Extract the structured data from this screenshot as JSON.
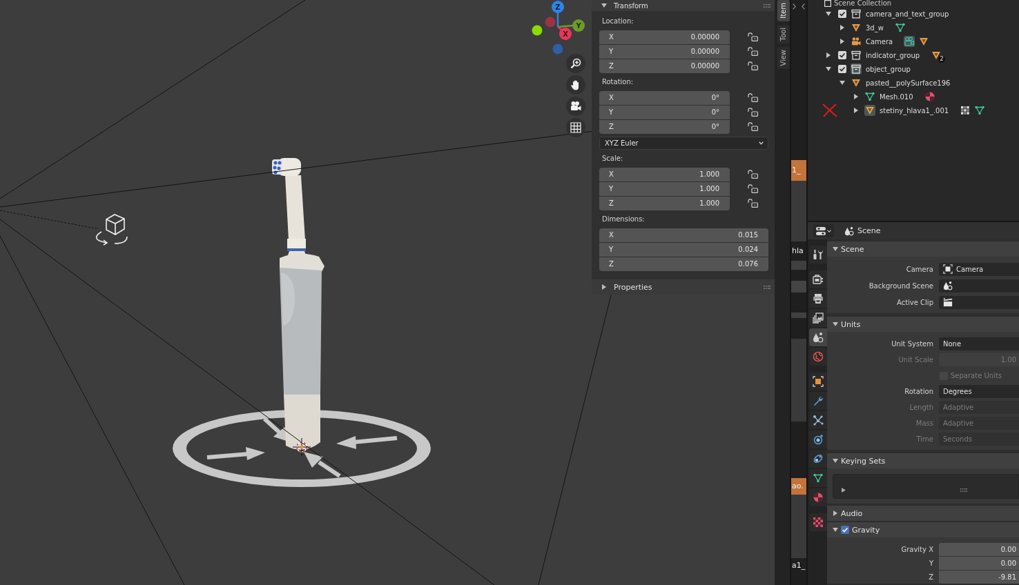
{
  "viewport": {
    "gizmo": {
      "axes": [
        {
          "label": "Z",
          "color": "#2f83e6"
        },
        {
          "label": "Y",
          "color": "#6f9a2d"
        },
        {
          "label": "X",
          "color": "#e8375a"
        }
      ]
    }
  },
  "sidebar": {
    "tabs": [
      {
        "label": "Item",
        "selected": true
      },
      {
        "label": "Tool",
        "selected": false
      },
      {
        "label": "View",
        "selected": false
      }
    ],
    "transform": {
      "title": "Transform",
      "expanded": true,
      "sections": [
        {
          "kind": "vector",
          "label": "Location:",
          "rows": [
            {
              "axis": "X",
              "value": "0.00000",
              "locked": false
            },
            {
              "axis": "Y",
              "value": "0.00000",
              "locked": false
            },
            {
              "axis": "Z",
              "value": "0.00000",
              "locked": false
            }
          ]
        },
        {
          "kind": "vector",
          "label": "Rotation:",
          "rows": [
            {
              "axis": "X",
              "value": "0°",
              "locked": false
            },
            {
              "axis": "Y",
              "value": "0°",
              "locked": false
            },
            {
              "axis": "Z",
              "value": "0°",
              "locked": false
            }
          ]
        },
        {
          "kind": "dropdown",
          "value": "XYZ Euler"
        },
        {
          "kind": "vector",
          "label": "Scale:",
          "rows": [
            {
              "axis": "X",
              "value": "1.000",
              "locked": false
            },
            {
              "axis": "Y",
              "value": "1.000",
              "locked": false
            },
            {
              "axis": "Z",
              "value": "1.000",
              "locked": false
            }
          ]
        },
        {
          "kind": "vector",
          "label": "Dimensions:",
          "rows": [
            {
              "axis": "X",
              "value": "0.015"
            },
            {
              "axis": "Y",
              "value": "0.024"
            },
            {
              "axis": "Z",
              "value": "0.076"
            }
          ]
        }
      ]
    },
    "properties": {
      "title": "Properties",
      "expanded": false
    }
  },
  "side_editor": {
    "strips": [
      {
        "text": "1_",
        "selected": true
      },
      {
        "text": "hla",
        "selected": false
      },
      {
        "text": "ao.",
        "selected": true
      },
      {
        "text": "a1_",
        "selected": false
      }
    ]
  },
  "outliner": {
    "root": {
      "label": "Scene Collection"
    },
    "items": [
      {
        "label": "camera_and_text_group",
        "kind": "collection",
        "checked": true,
        "expanded": true,
        "active": false,
        "crossed": false,
        "children": [
          {
            "label": "3d_w",
            "kind": "mesh",
            "expanded": false,
            "active": false,
            "crossed": false,
            "extras": [
              {
                "kind": "meshdata",
                "active": false
              }
            ]
          },
          {
            "label": "Camera",
            "kind": "camera",
            "expanded": false,
            "active": false,
            "crossed": false,
            "extras": [
              {
                "kind": "cameradata",
                "active": true
              },
              {
                "kind": "mesh",
                "active": false
              }
            ]
          }
        ]
      },
      {
        "label": "indicator_group",
        "kind": "collection",
        "checked": true,
        "expanded": false,
        "active": false,
        "crossed": false,
        "extras": [
          {
            "kind": "mesh",
            "active": false,
            "count": "2"
          }
        ]
      },
      {
        "label": "object_group",
        "kind": "collection",
        "checked": true,
        "expanded": true,
        "active": true,
        "crossed": false,
        "children": [
          {
            "label": "pasted__polySurface196",
            "kind": "mesh",
            "expanded": true,
            "active": false,
            "crossed": false,
            "children": [
              {
                "label": "Mesh.010",
                "kind": "meshdata",
                "expanded": false,
                "active": false,
                "crossed": false,
                "extras": [
                  {
                    "kind": "material",
                    "active": false
                  }
                ]
              },
              {
                "label": "stetiny_hlava1_.001",
                "kind": "mesh",
                "expanded": false,
                "active": true,
                "crossed": true,
                "extras": [
                  {
                    "kind": "modifier",
                    "active": false
                  },
                  {
                    "kind": "meshdata",
                    "active": false
                  }
                ]
              }
            ]
          }
        ]
      }
    ]
  },
  "properties": {
    "context": "Scene",
    "tab_groups": [
      {
        "tabs": [
          {
            "kind": "tool",
            "selected": false
          }
        ]
      },
      {
        "tabs": [
          {
            "kind": "render",
            "selected": false
          },
          {
            "kind": "output",
            "selected": false
          },
          {
            "kind": "viewlayer",
            "selected": false
          },
          {
            "kind": "scene",
            "selected": true
          },
          {
            "kind": "world",
            "selected": false
          }
        ]
      },
      {
        "tabs": [
          {
            "kind": "object",
            "selected": false
          },
          {
            "kind": "modifiers",
            "selected": false
          },
          {
            "kind": "particles",
            "selected": false
          },
          {
            "kind": "physics",
            "selected": false
          },
          {
            "kind": "constraints",
            "selected": false
          },
          {
            "kind": "data",
            "selected": false
          },
          {
            "kind": "material",
            "selected": false
          }
        ]
      },
      {
        "tabs": [
          {
            "kind": "texture",
            "selected": false
          }
        ]
      }
    ],
    "panels": [
      {
        "title": "Scene",
        "kind": "fields",
        "expanded": true,
        "rows": [
          {
            "label": "Camera",
            "kind": "camera",
            "value": "Camera",
            "disabled": false
          },
          {
            "label": "Background Scene",
            "kind": "scene",
            "disabled": false
          },
          {
            "label": "Active Clip",
            "kind": "clip",
            "disabled": false
          }
        ]
      },
      {
        "title": "Units",
        "kind": "fields",
        "expanded": true,
        "rows": [
          {
            "label": "Unit System",
            "kind": "menu",
            "value": "None",
            "disabled": false
          },
          {
            "label": "Unit Scale",
            "kind": "number",
            "value": "1.00",
            "disabled": true
          },
          {
            "label": "Separate Units",
            "kind": "checkbox",
            "checked": false,
            "disabled": true
          },
          {
            "label": "Rotation",
            "kind": "menu",
            "value": "Degrees",
            "disabled": false
          },
          {
            "label": "Length",
            "kind": "menu",
            "value": "Adaptive",
            "disabled": true
          },
          {
            "label": "Mass",
            "kind": "menu",
            "value": "Adaptive",
            "disabled": true
          },
          {
            "label": "Time",
            "kind": "menu",
            "value": "Seconds",
            "disabled": true
          }
        ]
      },
      {
        "title": "Keying Sets",
        "kind": "list",
        "expanded": true
      },
      {
        "title": "Audio",
        "expanded": false
      },
      {
        "title": "Gravity",
        "kind": "fields",
        "expanded": true,
        "checked": true,
        "rows": [
          {
            "label": "Gravity X",
            "kind": "number",
            "value": "0.00",
            "disabled": false
          },
          {
            "label": "Y",
            "kind": "number",
            "value": "0.00",
            "disabled": false
          },
          {
            "label": "Z",
            "kind": "number",
            "value": "-9.81",
            "disabled": false
          }
        ]
      }
    ]
  }
}
